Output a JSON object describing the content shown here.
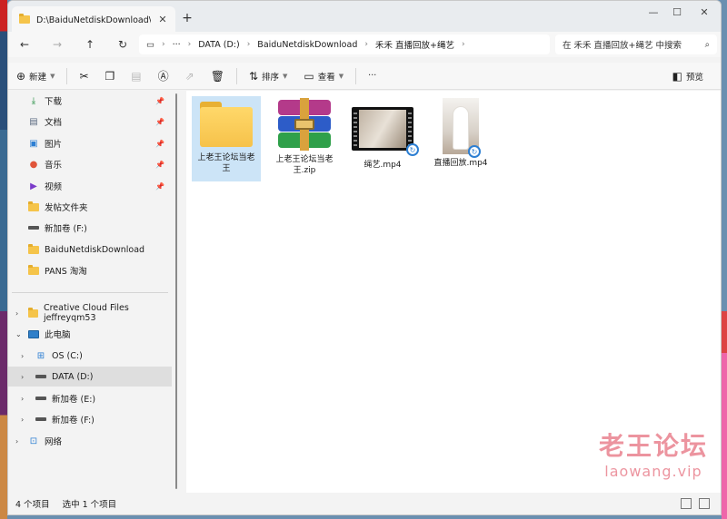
{
  "tab": {
    "title": "D:\\BaiduNetdiskDownload\\禾禾"
  },
  "window_controls": {
    "minimize": "—",
    "maximize": "☐",
    "close": "✕"
  },
  "address": {
    "crumbs": [
      "DATA (D:)",
      "BaiduNetdiskDownload",
      "禾禾 直播回放+绳艺"
    ]
  },
  "search": {
    "placeholder": "在 禾禾 直播回放+绳艺 中搜索"
  },
  "commands": {
    "new": "新建",
    "sort": "排序",
    "view": "查看",
    "more": "···",
    "preview": "预览"
  },
  "sidebar": {
    "quick": [
      {
        "label": "下载",
        "icon": "download-icon"
      },
      {
        "label": "文档",
        "icon": "documents-icon"
      },
      {
        "label": "图片",
        "icon": "pictures-icon"
      },
      {
        "label": "音乐",
        "icon": "music-icon"
      },
      {
        "label": "视频",
        "icon": "videos-icon"
      },
      {
        "label": "发帖文件夹",
        "icon": "folder-icon"
      },
      {
        "label": "新加卷 (F:)",
        "icon": "drive-icon"
      },
      {
        "label": "BaiduNetdiskDownload",
        "icon": "folder-icon"
      },
      {
        "label": "PANS 淘淘",
        "icon": "folder-icon"
      }
    ],
    "tree": [
      {
        "label": "Creative Cloud Files  jeffreyqm53",
        "icon": "folder-icon"
      },
      {
        "label": "此电脑",
        "icon": "pc-icon"
      },
      {
        "label": "OS (C:)",
        "icon": "drive-icon"
      },
      {
        "label": "DATA (D:)",
        "icon": "drive-icon"
      },
      {
        "label": "新加卷 (E:)",
        "icon": "drive-icon"
      },
      {
        "label": "新加卷 (F:)",
        "icon": "drive-icon"
      },
      {
        "label": "网络",
        "icon": "network-icon"
      }
    ]
  },
  "files": [
    {
      "name": "上老王论坛当老王",
      "type": "folder"
    },
    {
      "name": "上老王论坛当老王.zip",
      "type": "zip"
    },
    {
      "name": "绳艺.mp4",
      "type": "video"
    },
    {
      "name": "直播回放.mp4",
      "type": "video"
    }
  ],
  "status": {
    "count": "4 个项目",
    "selected": "选中 1 个项目"
  },
  "watermark": {
    "line1": "老王论坛",
    "line2": "laowang.vip"
  },
  "colors": {
    "selection": "#cce4f7",
    "folder": "#f6c24a",
    "accent": "#2d7fd3"
  }
}
